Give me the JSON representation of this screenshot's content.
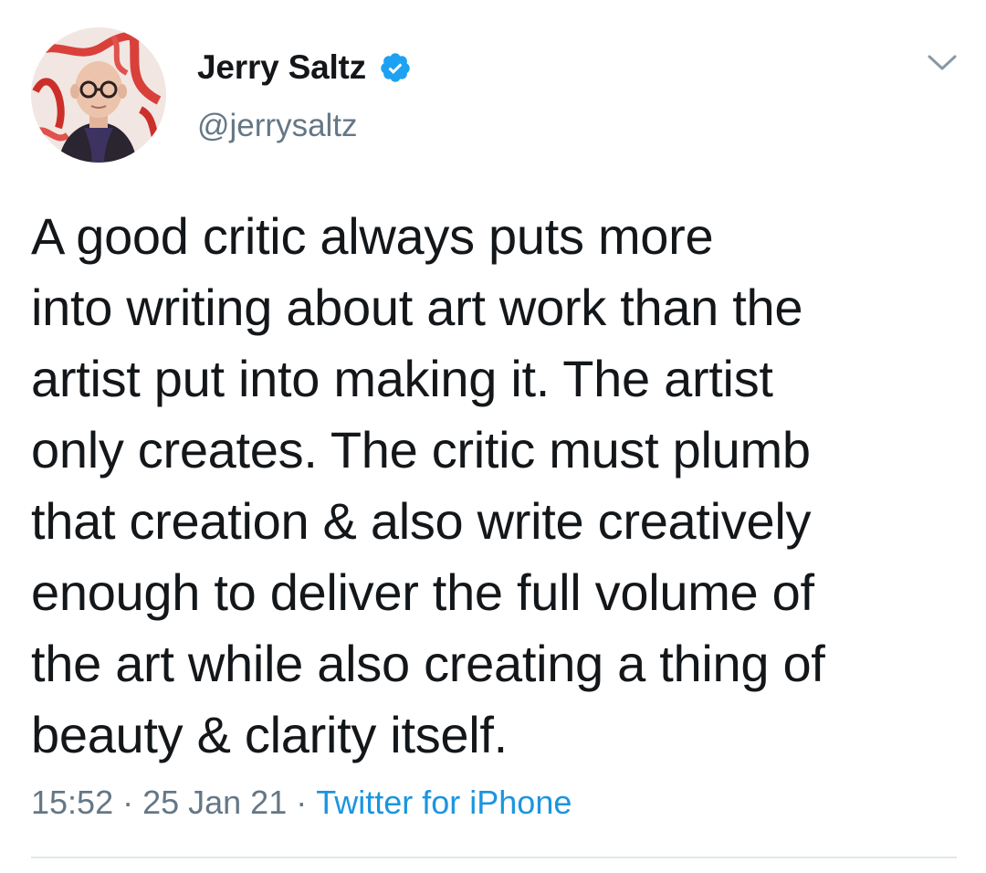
{
  "author": {
    "display_name": "Jerry Saltz",
    "handle": "@jerrysaltz",
    "verified": true,
    "verified_icon": "verified-badge-icon",
    "avatar_icon": "profile-avatar"
  },
  "menu": {
    "icon": "chevron-down-icon"
  },
  "tweet": {
    "lines": [
      "A good critic always puts more",
      "into writing about art work than the",
      "artist put into making it. The artist",
      "only creates. The critic must plumb",
      "that creation & also write creatively",
      "enough to deliver the full volume of",
      "the art while also creating a thing of",
      "beauty & clarity itself."
    ],
    "time": "15:52",
    "separator": "·",
    "date": "25 Jan 21",
    "source": "Twitter for iPhone"
  },
  "colors": {
    "text": "#14171a",
    "secondary": "#657786",
    "link": "#1b95e0",
    "verified": "#1da1f2",
    "divider": "#e1e8ed"
  }
}
